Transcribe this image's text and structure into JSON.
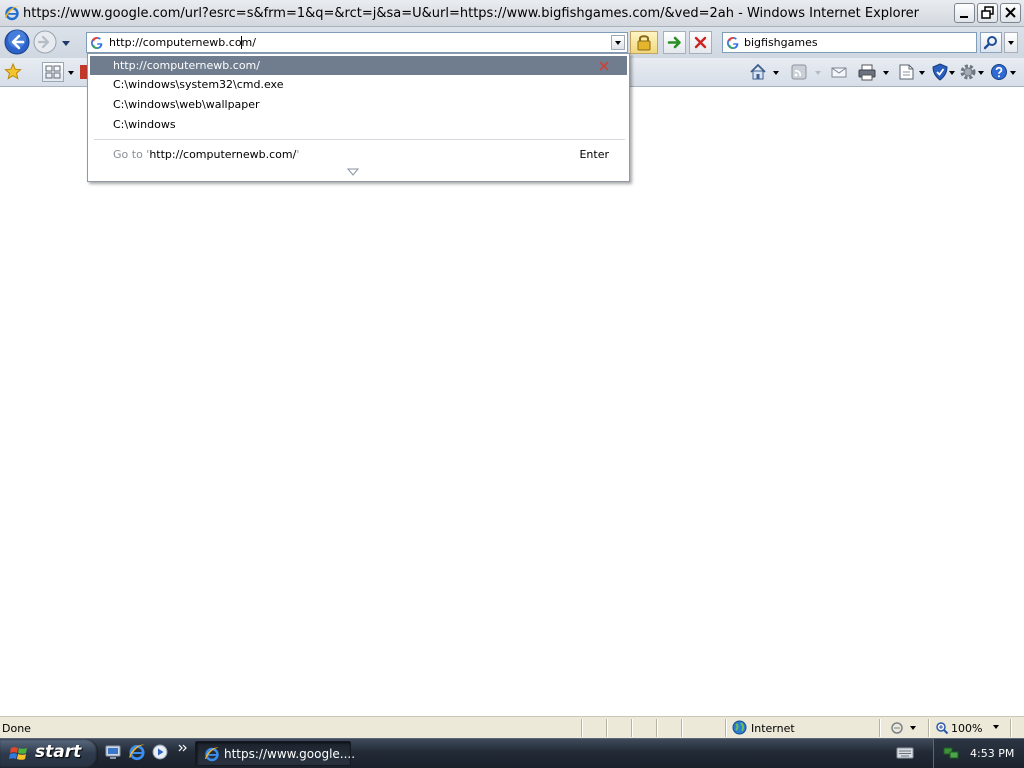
{
  "window": {
    "title": "https://www.google.com/url?esrc=s&frm=1&q=&rct=j&sa=U&url=https://www.bigfishgames.com/&ved=2ah - Windows Internet Explorer",
    "icon": "ie-icon",
    "controls": [
      "minimize",
      "restore",
      "close"
    ]
  },
  "navigation": {
    "address_value": "http://computernewb.com/",
    "search_value": "bigfishgames",
    "search_provider_icon": "google-icon"
  },
  "autocomplete": {
    "items": [
      {
        "label": "http://computernewb.com/",
        "selected": true
      },
      {
        "label": "C:\\windows\\system32\\cmd.exe",
        "selected": false
      },
      {
        "label": "C:\\windows\\web\\wallpaper",
        "selected": false
      },
      {
        "label": "C:\\windows",
        "selected": false
      }
    ],
    "goto_prefix": "Go to '",
    "goto_url": "http://computernewb.com/",
    "goto_suffix": "'",
    "enter_label": "Enter"
  },
  "status": {
    "text": "Done",
    "zone": "Internet",
    "zoom": "100%"
  },
  "taskbar": {
    "start_label": "start",
    "quicklaunch": [
      "desktop-icon",
      "ie-icon",
      "media-player-icon"
    ],
    "window_button": "https://www.google....",
    "clock": "4:53 PM"
  },
  "colors": {
    "selection": "#6f7d8e",
    "back_button": "#2a62c9",
    "taskbar": "#222a36"
  }
}
